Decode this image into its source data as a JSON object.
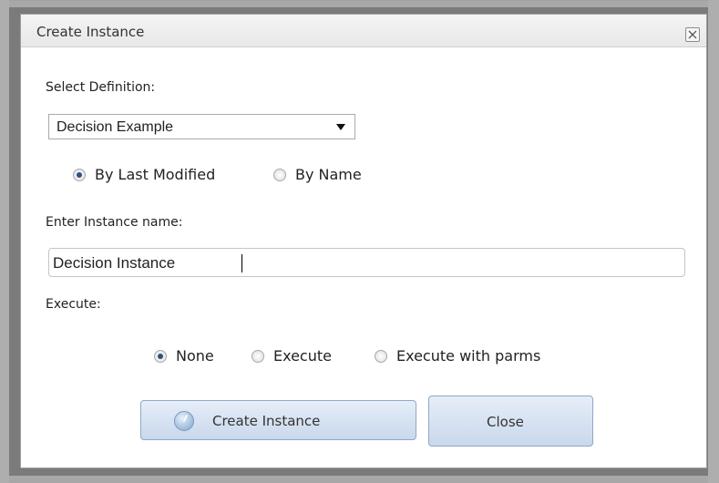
{
  "dialog": {
    "title": "Create Instance",
    "close_icon": "close-icon"
  },
  "definition": {
    "label": "Select Definition:",
    "selected": "Decision Example",
    "sort_options": [
      {
        "label": "By Last Modified",
        "checked": true
      },
      {
        "label": "By Name",
        "checked": false
      }
    ]
  },
  "instance": {
    "label": "Enter Instance name:",
    "value": "Decision Instance"
  },
  "execute": {
    "label": "Execute:",
    "options": [
      {
        "label": "None",
        "checked": true
      },
      {
        "label": "Execute",
        "checked": false
      },
      {
        "label": "Execute with parms",
        "checked": false
      }
    ]
  },
  "buttons": {
    "create_label": "Create Instance",
    "create_icon": "clock-icon",
    "close_label": "Close"
  },
  "colors": {
    "button_gradient_top": "#e6eef8",
    "button_gradient_bottom": "#c9d8ec",
    "button_border": "#8fa8c8",
    "radio_dot": "#2f4f7f"
  }
}
